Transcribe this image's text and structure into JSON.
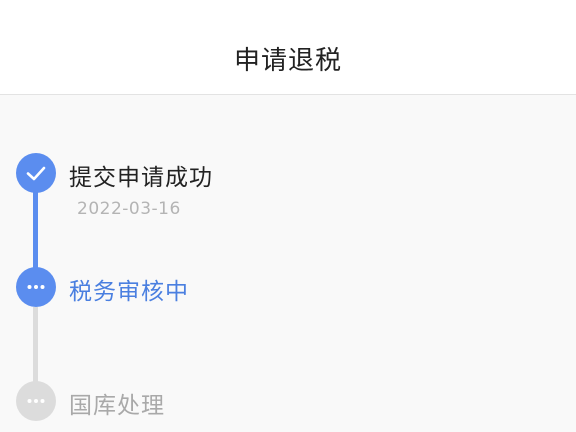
{
  "header": {
    "title": "申请退税"
  },
  "steps": [
    {
      "label": "提交申请成功",
      "date": "2022-03-16",
      "state": "done",
      "icon": "check-icon"
    },
    {
      "label": "税务审核中",
      "state": "active",
      "icon": "ellipsis-icon"
    },
    {
      "label": "国库处理",
      "state": "pending",
      "icon": "ellipsis-icon"
    }
  ],
  "colors": {
    "accent": "#5b8def",
    "accent_text": "#4a7fe0",
    "pending": "#dcdcdc",
    "pending_text": "#a9a9a9"
  }
}
